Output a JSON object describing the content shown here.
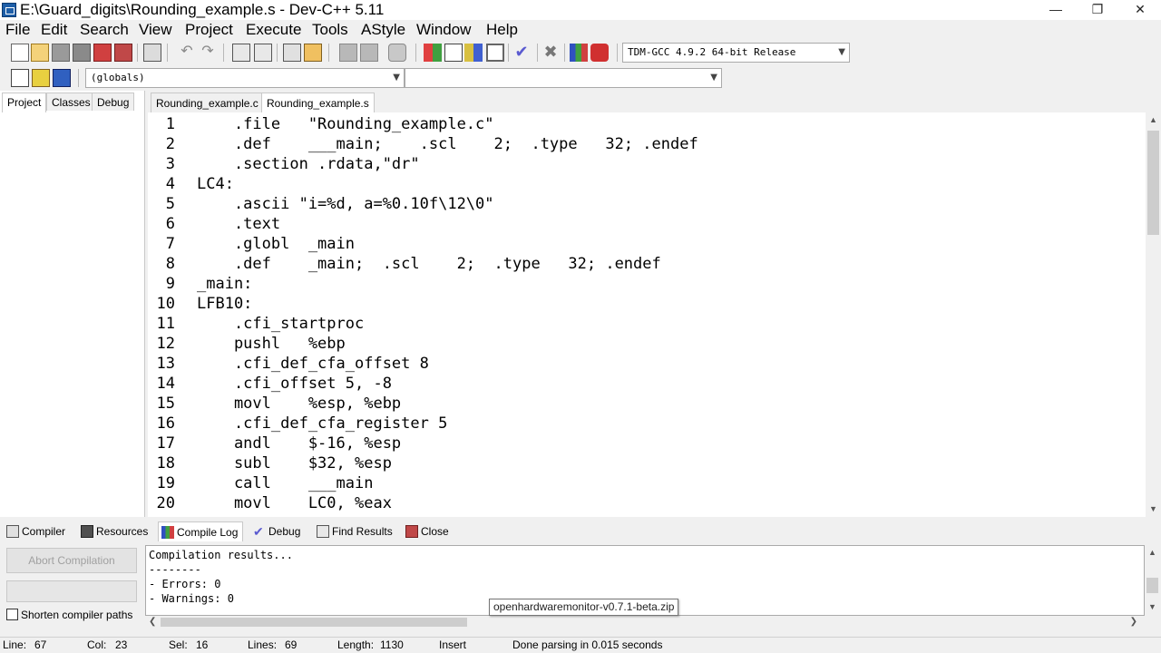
{
  "window": {
    "title": "E:\\Guard_digits\\Rounding_example.s - Dev-C++ 5.11",
    "minimize_glyph": "—",
    "restore_glyph": "❐",
    "close_glyph": "✕"
  },
  "menu": {
    "file": "File",
    "edit": "Edit",
    "search": "Search",
    "view": "View",
    "project": "Project",
    "execute": "Execute",
    "tools": "Tools",
    "astyle": "AStyle",
    "window": "Window",
    "help": "Help"
  },
  "toolbar": {
    "compiler_select": "TDM-GCC 4.9.2 64-bit Release",
    "globals_select": "(globals)",
    "members_select": ""
  },
  "left_tabs": {
    "project": "Project",
    "classes": "Classes",
    "debug": "Debug"
  },
  "editor_tabs": {
    "tab1": "Rounding_example.c",
    "tab2": "Rounding_example.s"
  },
  "editor": {
    "lines": [
      {
        "n": "1",
        "code": "    .file   \"Rounding_example.c\""
      },
      {
        "n": "2",
        "code": "    .def    ___main;    .scl    2;  .type   32; .endef"
      },
      {
        "n": "3",
        "code": "    .section .rdata,\"dr\""
      },
      {
        "n": "4",
        "code": "LC4:"
      },
      {
        "n": "5",
        "code": "    .ascii \"i=%d, a=%0.10f\\12\\0\""
      },
      {
        "n": "6",
        "code": "    .text"
      },
      {
        "n": "7",
        "code": "    .globl  _main"
      },
      {
        "n": "8",
        "code": "    .def    _main;  .scl    2;  .type   32; .endef"
      },
      {
        "n": "9",
        "code": "_main:"
      },
      {
        "n": "10",
        "code": "LFB10:"
      },
      {
        "n": "11",
        "code": "    .cfi_startproc"
      },
      {
        "n": "12",
        "code": "    pushl   %ebp"
      },
      {
        "n": "13",
        "code": "    .cfi_def_cfa_offset 8"
      },
      {
        "n": "14",
        "code": "    .cfi_offset 5, -8"
      },
      {
        "n": "15",
        "code": "    movl    %esp, %ebp"
      },
      {
        "n": "16",
        "code": "    .cfi_def_cfa_register 5"
      },
      {
        "n": "17",
        "code": "    andl    $-16, %esp"
      },
      {
        "n": "18",
        "code": "    subl    $32, %esp"
      },
      {
        "n": "19",
        "code": "    call    ___main"
      },
      {
        "n": "20",
        "code": "    movl    LC0, %eax"
      }
    ]
  },
  "bottom_tabs": {
    "compiler": "Compiler",
    "resources": "Resources",
    "compile_log": "Compile Log",
    "debug": "Debug",
    "find_results": "Find Results",
    "close": "Close"
  },
  "compile_panel": {
    "abort_label": "Abort Compilation",
    "shorten_label": "Shorten compiler paths",
    "log_lines": [
      "Compilation results...",
      "--------",
      "- Errors: 0",
      "- Warnings: 0"
    ]
  },
  "tooltip": "openhardwaremonitor-v0.7.1-beta.zip",
  "status": {
    "line_label": "Line:",
    "line_value": "67",
    "col_label": "Col:",
    "col_value": "23",
    "sel_label": "Sel:",
    "sel_value": "16",
    "lines_label": "Lines:",
    "lines_value": "69",
    "length_label": "Length:",
    "length_value": "1130",
    "mode": "Insert",
    "message": "Done parsing in 0.015 seconds"
  }
}
